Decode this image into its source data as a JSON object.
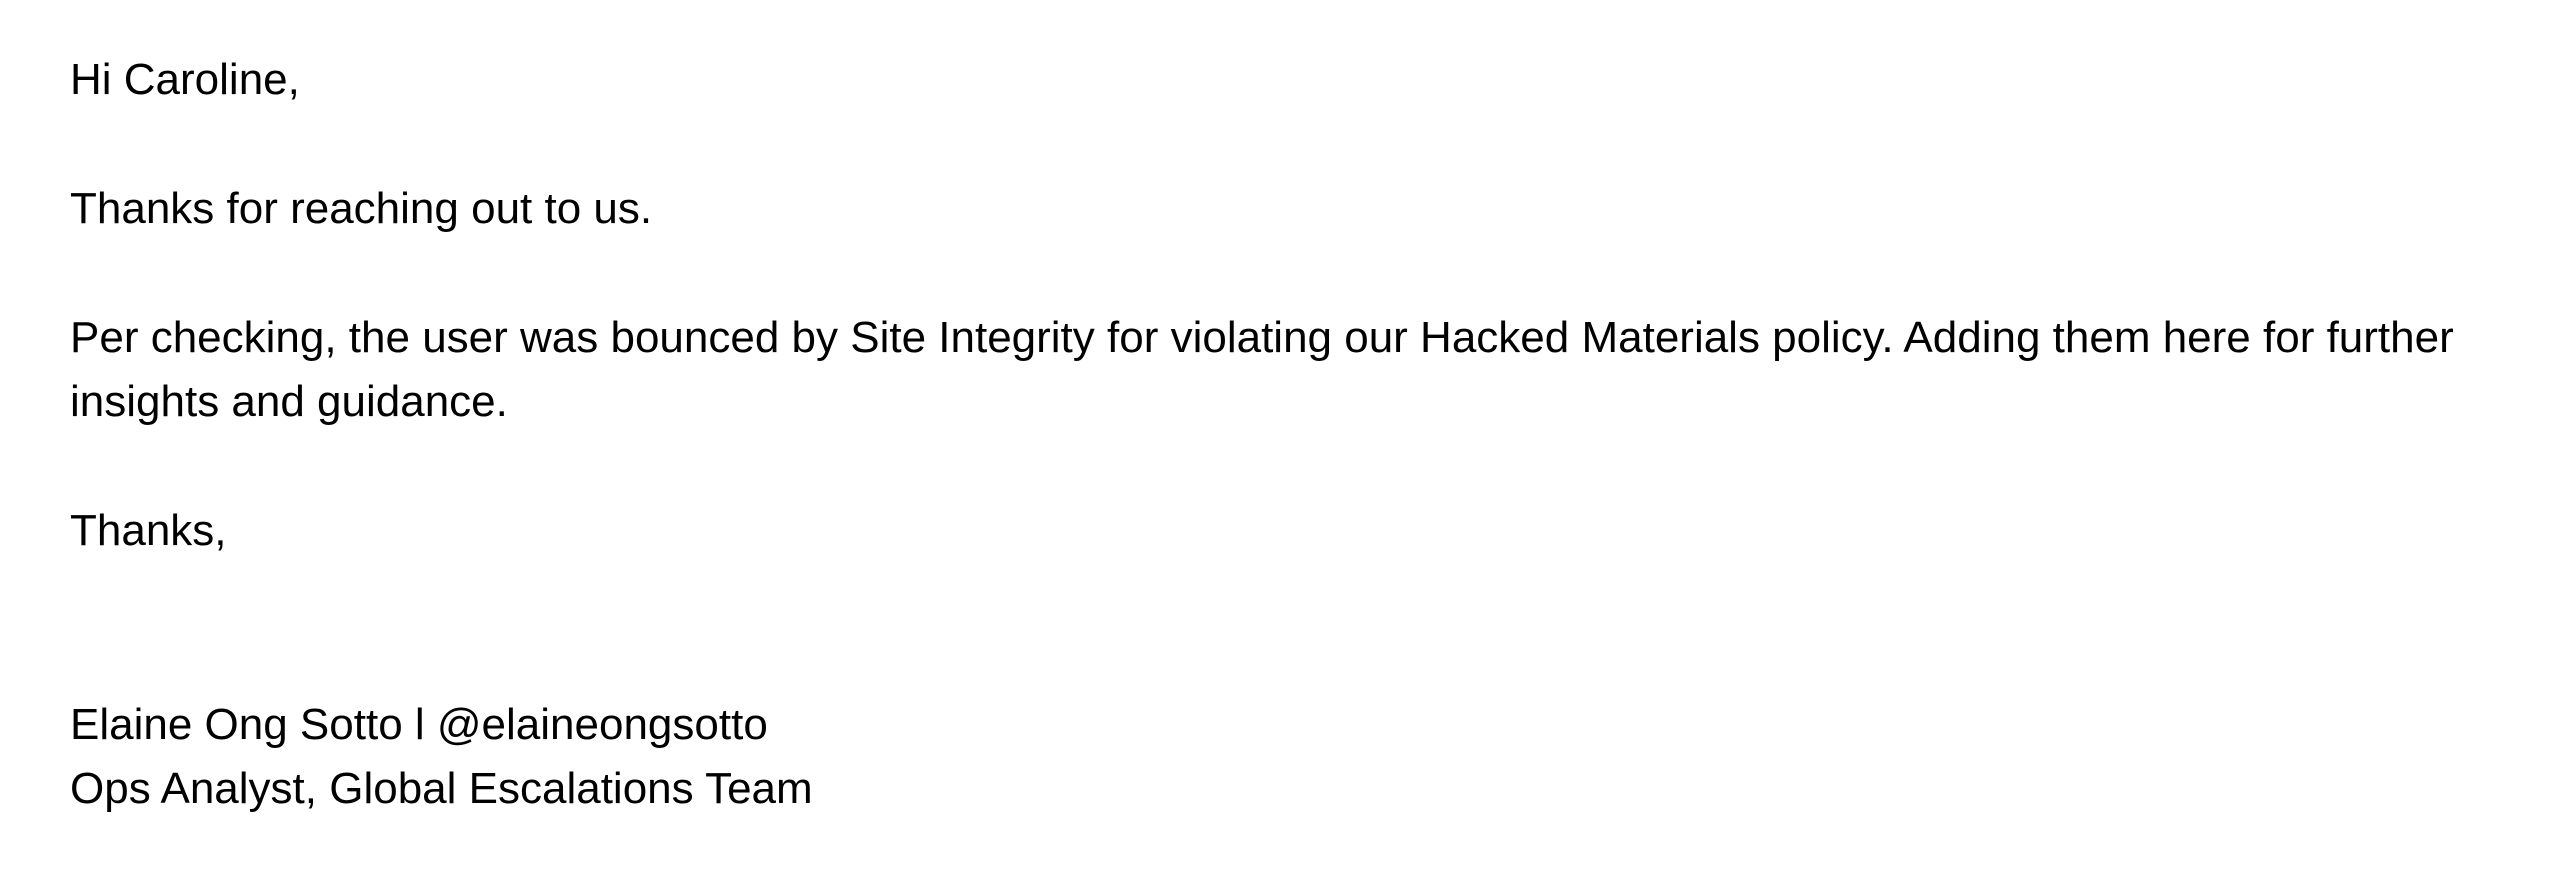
{
  "email": {
    "greeting": "Hi Caroline,",
    "intro": "Thanks for reaching out to us.",
    "details": "Per checking, the user was bounced by Site Integrity for violating our Hacked Materials policy. Adding them here for further insights and guidance.",
    "signoff": "Thanks,",
    "signature": {
      "name_line": "Elaine Ong Sotto l @elaineongsotto",
      "title_line": "Ops Analyst, Global Escalations Team"
    }
  }
}
